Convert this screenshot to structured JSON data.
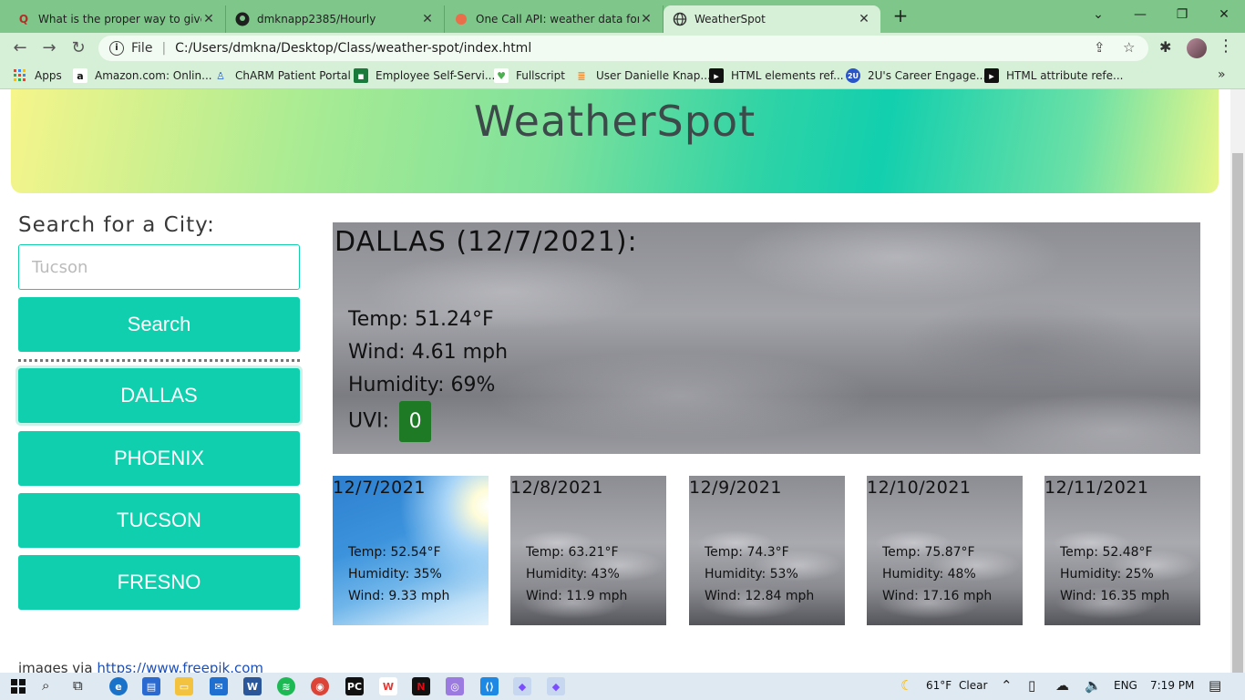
{
  "browser": {
    "tabs": [
      {
        "title": "What is the proper way to give c",
        "icon": "quora-icon",
        "color": "#b92b27"
      },
      {
        "title": "dmknapp2385/Hourly",
        "icon": "github-icon",
        "color": "#1f1f1f"
      },
      {
        "title": "One Call API: weather data for ar",
        "icon": "openweather-icon",
        "color": "#eb6e4b"
      },
      {
        "title": "WeatherSpot",
        "icon": "globe-icon",
        "color": "#333333"
      }
    ],
    "address": {
      "scheme": "File",
      "url": "C:/Users/dmkna/Desktop/Class/weather-spot/index.html"
    },
    "bookmarks": [
      {
        "label": "Apps",
        "icon": "apps-grid-icon"
      },
      {
        "label": "Amazon.com: Onlin...",
        "icon": "amazon-icon"
      },
      {
        "label": "ChARM Patient Portal",
        "icon": "charm-icon"
      },
      {
        "label": "Employee Self-Servi...",
        "icon": "employee-icon"
      },
      {
        "label": "Fullscript",
        "icon": "fullscript-icon"
      },
      {
        "label": "User Danielle Knap...",
        "icon": "stack-icon"
      },
      {
        "label": "HTML elements ref...",
        "icon": "mdn-icon"
      },
      {
        "label": "2U's Career Engage...",
        "icon": "2u-icon"
      },
      {
        "label": "HTML attribute refe...",
        "icon": "mdn-icon"
      }
    ]
  },
  "page": {
    "title": "WeatherSpot",
    "search": {
      "label": "Search for a City:",
      "placeholder": "Tucson",
      "button": "Search"
    },
    "history": [
      "DALLAS",
      "PHOENIX",
      "TUCSON",
      "FRESNO"
    ],
    "current": {
      "heading": "DALLAS (12/7/2021):",
      "temp": "Temp: 51.24°F",
      "wind": "Wind: 4.61 mph",
      "humidity": "Humidity: 69%",
      "uvi_label": "UVI:",
      "uvi_value": "0"
    },
    "forecast": [
      {
        "date": "12/7/2021",
        "temp": "Temp: 52.54°F",
        "humidity": "Humidity: 35%",
        "wind": "Wind: 9.33 mph",
        "sky": "sunny"
      },
      {
        "date": "12/8/2021",
        "temp": "Temp: 63.21°F",
        "humidity": "Humidity: 43%",
        "wind": "Wind: 11.9 mph",
        "sky": "cloudy"
      },
      {
        "date": "12/9/2021",
        "temp": "Temp: 74.3°F",
        "humidity": "Humidity: 53%",
        "wind": "Wind: 12.84 mph",
        "sky": "cloudy"
      },
      {
        "date": "12/10/2021",
        "temp": "Temp: 75.87°F",
        "humidity": "Humidity: 48%",
        "wind": "Wind: 17.16 mph",
        "sky": "cloudy"
      },
      {
        "date": "12/11/2021",
        "temp": "Temp: 52.48°F",
        "humidity": "Humidity: 25%",
        "wind": "Wind: 16.35 mph",
        "sky": "cloudy"
      }
    ],
    "credit_text": "images via ",
    "credit_link": "https://www.freepik.com"
  },
  "taskbar": {
    "weather": "61°F",
    "weather_desc": "Clear",
    "language": "ENG",
    "time": "7:19 PM"
  },
  "colors": {
    "accent": "#10cfae",
    "uvi_low": "#1e7a25",
    "chrome": "#7fc68a"
  }
}
